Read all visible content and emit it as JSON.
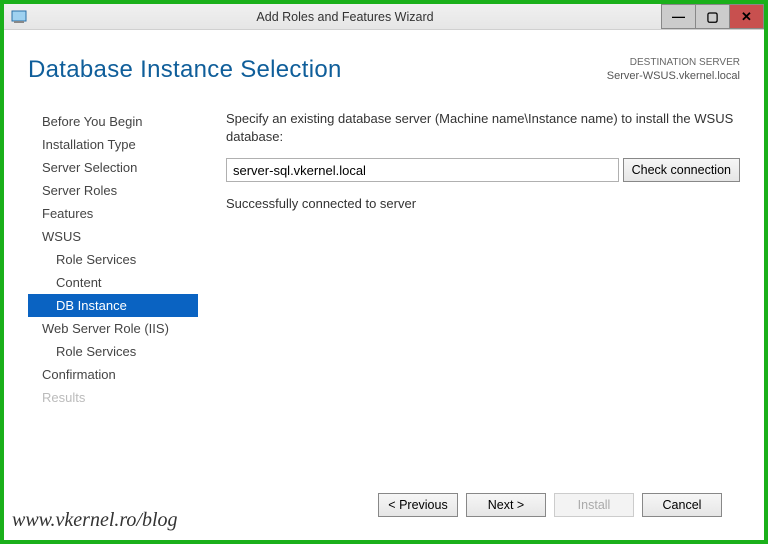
{
  "window": {
    "title": "Add Roles and Features Wizard"
  },
  "header": {
    "title": "Database Instance Selection",
    "destination_label": "DESTINATION SERVER",
    "destination_value": "Server-WSUS.vkernel.local"
  },
  "sidebar": {
    "items": [
      {
        "label": "Before You Begin",
        "indent": 0
      },
      {
        "label": "Installation Type",
        "indent": 0
      },
      {
        "label": "Server Selection",
        "indent": 0
      },
      {
        "label": "Server Roles",
        "indent": 0
      },
      {
        "label": "Features",
        "indent": 0
      },
      {
        "label": "WSUS",
        "indent": 0
      },
      {
        "label": "Role Services",
        "indent": 1
      },
      {
        "label": "Content",
        "indent": 1
      },
      {
        "label": "DB Instance",
        "indent": 1,
        "selected": true
      },
      {
        "label": "Web Server Role (IIS)",
        "indent": 0
      },
      {
        "label": "Role Services",
        "indent": 1
      },
      {
        "label": "Confirmation",
        "indent": 0
      },
      {
        "label": "Results",
        "indent": 0,
        "disabled": true
      }
    ]
  },
  "main": {
    "instruction": "Specify an existing database server (Machine name\\Instance name) to install the WSUS database:",
    "input_value": "server-sql.vkernel.local",
    "check_button": "Check connection",
    "status": "Successfully connected to server"
  },
  "footer": {
    "previous": "< Previous",
    "next": "Next >",
    "install": "Install",
    "cancel": "Cancel"
  },
  "watermark": "www.vkernel.ro/blog"
}
